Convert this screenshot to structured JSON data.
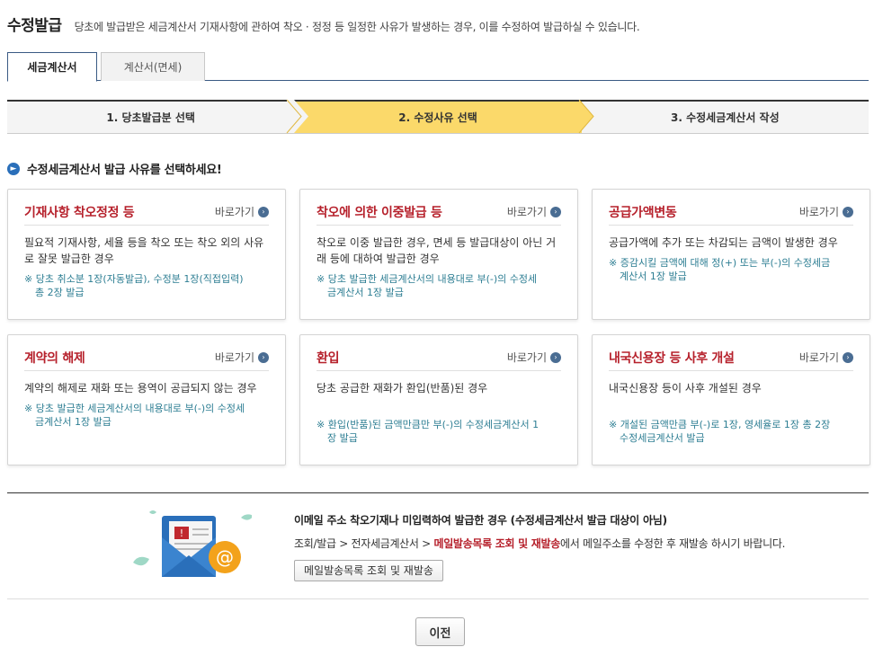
{
  "header": {
    "title": "수정발급",
    "description": "당초에 발급받은 세금계산서 기재사항에 관하여 착오 · 정정 등 일정한 사유가 발생하는 경우, 이를 수정하여 발급하실 수 있습니다."
  },
  "tabs": [
    {
      "label": "세금계산서",
      "active": true
    },
    {
      "label": "계산서(면세)",
      "active": false
    }
  ],
  "steps": [
    {
      "label": "1. 당초발급분 선택",
      "current": false
    },
    {
      "label": "2. 수정사유 선택",
      "current": true
    },
    {
      "label": "3. 수정세금계산서 작성",
      "current": false
    }
  ],
  "section_title": "수정세금계산서 발급 사유를 선택하세요!",
  "goto_label": "바로가기",
  "cards": [
    {
      "title": "기재사항 착오정정 등",
      "desc": "필요적 기재사항, 세율 등을 착오 또는 착오 외의 사유로 잘못 발급한 경우",
      "note1": "※ 당초 취소분 1장(자동발급), 수정분 1장(직접입력)",
      "note2": "총 2장 발급"
    },
    {
      "title": "착오에 의한 이중발급 등",
      "desc": "착오로 이중 발급한 경우, 면세 등 발급대상이 아닌 거래 등에 대하여 발급한 경우",
      "note1": "※ 당초 발급한 세금계산서의 내용대로 부(-)의 수정세",
      "note2": "금계산서 1장 발급"
    },
    {
      "title": "공급가액변동",
      "desc": "공급가액에 추가 또는 차감되는 금액이 발생한 경우",
      "note1": "※ 증감시킬 금액에 대해 정(+) 또는 부(-)의 수정세금",
      "note2": "계산서 1장 발급"
    },
    {
      "title": "계약의 해제",
      "desc": "계약의 해제로 재화 또는 용역이 공급되지 않는 경우",
      "note1": "※ 당초 발급한 세금계산서의 내용대로 부(-)의 수정세",
      "note2": "금계산서 1장 발급"
    },
    {
      "title": "환입",
      "desc": "당초 공급한 재화가 환입(반품)된 경우",
      "note1": "※ 환입(반품)된 금액만큼만 부(-)의 수정세금계산서 1",
      "note2": "장 발급"
    },
    {
      "title": "내국신용장 등 사후 개설",
      "desc": "내국신용장 등이 사후 개설된 경우",
      "note1": "※ 개설된 금액만큼 부(-)로 1장, 영세율로 1장 총 2장",
      "note2": "수정세금계산서 발급"
    }
  ],
  "mail": {
    "title": "이메일 주소 착오기재나 미입력하여 발급한 경우 (수정세금계산서 발급 대상이 아님)",
    "path": "조회/발급 > 전자세금계산서 > ",
    "highlight": "메일발송목록 조회 및 재발송",
    "suffix": "에서 메일주소를 수정한 후 재발송 하시기 바랍니다.",
    "button": "메일발송목록 조회 및 재발송"
  },
  "prev_button": "이전",
  "colors": {
    "accent_red": "#b6202b",
    "step_current": "#fbd96a",
    "note_teal": "#2d7e93",
    "tab_border": "#3a5a84"
  }
}
